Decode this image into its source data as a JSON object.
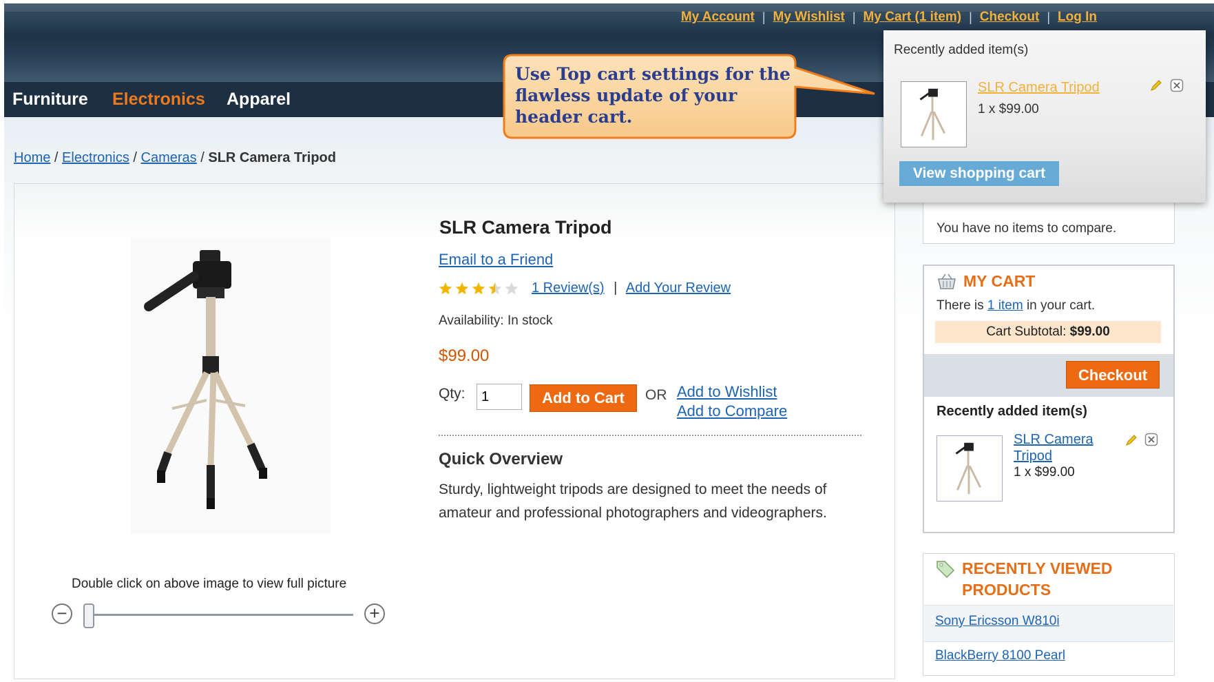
{
  "header": {
    "links": [
      "My Account",
      "My Wishlist",
      "My Cart (1 item)",
      "Checkout",
      "Log In"
    ],
    "nav": [
      "Furniture",
      "Electronics",
      "Apparel"
    ],
    "nav_active": "Electronics",
    "colors": {
      "accent": "#ed6a12",
      "link": "#1e64b4",
      "toplink": "#f3b13c",
      "nav_active": "#e56f18"
    }
  },
  "callout": {
    "text": "Use Top cart settings for the flawless update  of your header cart."
  },
  "breadcrumb": {
    "items": [
      "Home",
      "Electronics",
      "Cameras"
    ],
    "current": "SLR Camera Tripod",
    "separator": "/"
  },
  "product": {
    "title": "SLR Camera Tripod",
    "email_link": "Email to a Friend",
    "rating": {
      "value": 3.5,
      "max": 5
    },
    "reviews_link": "1 Review(s)",
    "add_review_link": "Add Your Review",
    "review_separator": "|",
    "availability": "Availability: In stock",
    "price": "$99.00",
    "qty_label": "Qty:",
    "qty_value": "1",
    "add_to_cart": "Add to Cart",
    "or_text": "OR",
    "wishlist_link": "Add to Wishlist",
    "compare_link": "Add to Compare",
    "quick_overview_title": "Quick Overview",
    "description": "Sturdy, lightweight tripods are designed to meet the needs of amateur and professional photographers and videographers.",
    "image_hint": "Double click on above image to view full picture",
    "zoom_out": "−",
    "zoom_in": "+"
  },
  "dropdown_cart": {
    "title": "Recently added item(s)",
    "item_name": "SLR Camera Tripod",
    "item_qty": "1 x $99.00",
    "view_cart": "View shopping cart"
  },
  "sidebar": {
    "compare_text": "You have no items to compare.",
    "my_cart": {
      "title": "MY CART",
      "line_prefix": "There is ",
      "line_link": "1 item",
      "line_suffix": " in your cart.",
      "subtotal_label": "Cart Subtotal:",
      "subtotal_value": "$99.00",
      "checkout": "Checkout",
      "recent_title": "Recently added item(s)",
      "item_name": "SLR Camera Tripod",
      "item_qty": "1 x $99.00"
    },
    "recently_viewed": {
      "title": "RECENTLY VIEWED PRODUCTS",
      "items": [
        "Sony Ericsson W810i",
        "BlackBerry 8100 Pearl"
      ]
    }
  }
}
